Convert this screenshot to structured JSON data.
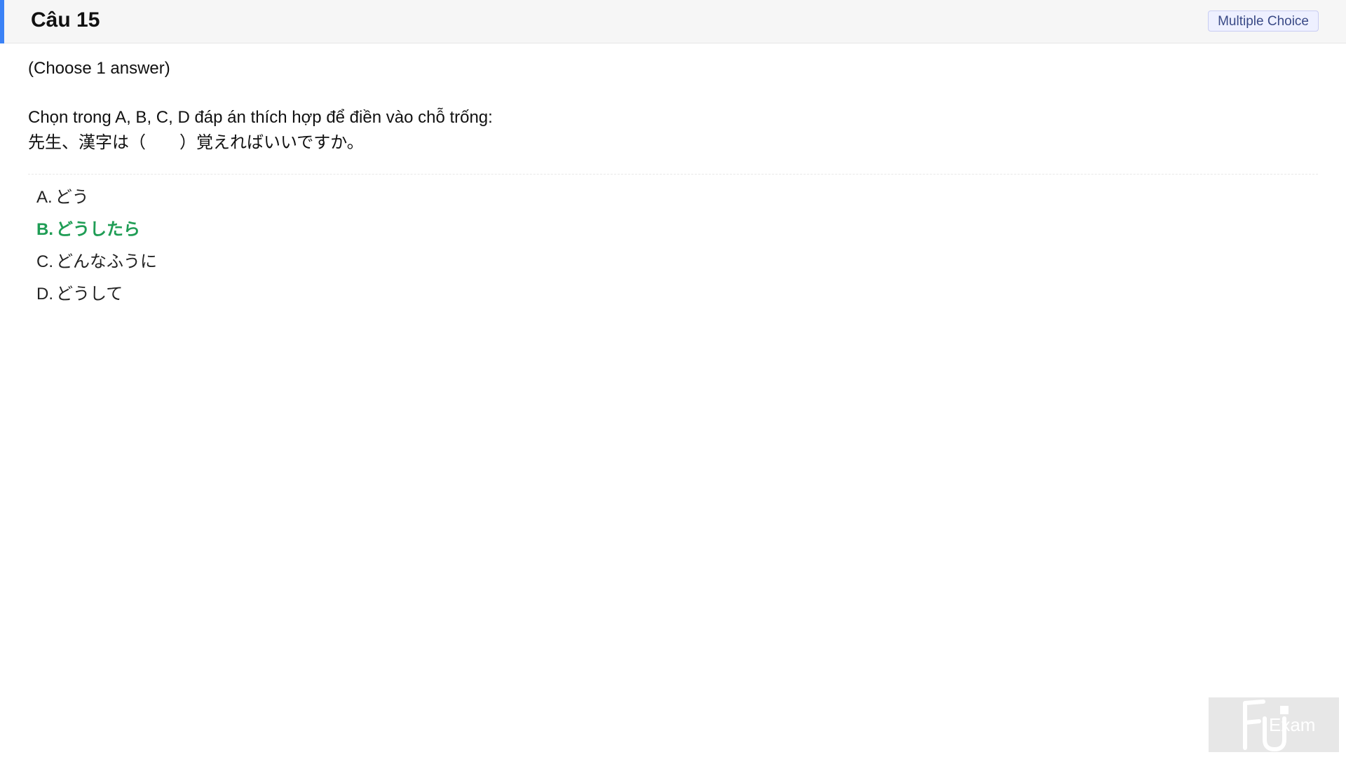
{
  "header": {
    "title": "Câu 15",
    "badge": "Multiple Choice",
    "accent_color": "#3b82f6"
  },
  "question": {
    "instruction": "(Choose 1 answer)",
    "prompt_lines": [
      "Chọn trong A, B, C, D đáp án thích hợp để điền vào chỗ trống:",
      "先生、漢字は（　　）覚えればいいですか。"
    ]
  },
  "options": [
    {
      "letter": "A.",
      "text": "どう",
      "correct": false
    },
    {
      "letter": "B.",
      "text": "どうしたら",
      "correct": true
    },
    {
      "letter": "C.",
      "text": "どんなふうに",
      "correct": false
    },
    {
      "letter": "D.",
      "text": "どうして",
      "correct": false
    }
  ],
  "watermark": {
    "logo_text": "Exam",
    "icon": "fu-exam-logo"
  },
  "colors": {
    "correct": "#1f9d55",
    "badge_text": "#3a4a86"
  }
}
